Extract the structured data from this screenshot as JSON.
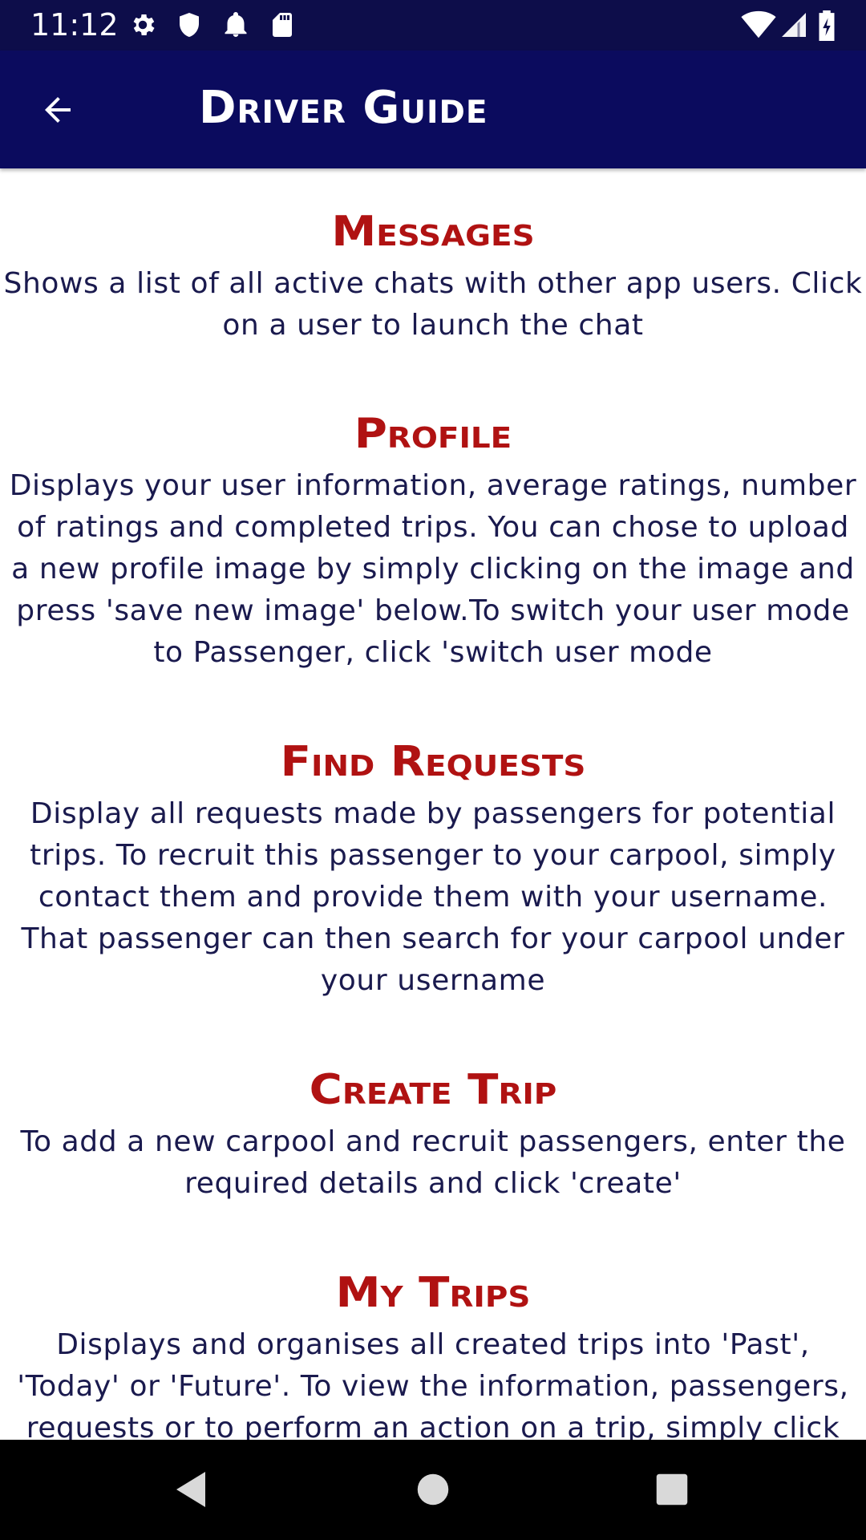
{
  "status_bar": {
    "time": "11:12",
    "left_icons": [
      "gear-icon",
      "shield-icon",
      "bell-icon",
      "sd-card-icon"
    ],
    "right_icons": [
      "wifi-icon",
      "signal-icon",
      "battery-charging-icon"
    ]
  },
  "app_bar": {
    "title": "Driver Guide",
    "back_icon": "arrow-back-icon"
  },
  "sections": [
    {
      "title": "Messages",
      "text": "Shows a list of all active chats with other app users. Click on a user to launch the chat"
    },
    {
      "title": "Profile",
      "text": "Displays your user information, average ratings, number of ratings and completed trips. You can chose to upload a new profile image by simply clicking on the image and press 'save new image' below.To switch your user mode to Passenger, click 'switch user mode"
    },
    {
      "title": "Find Requests",
      "text": "Display all requests made by passengers for potential trips. To recruit this passenger to your carpool, simply contact them and provide them with your username. That passenger can then search for your carpool under your username"
    },
    {
      "title": "Create Trip",
      "text": "To add a new carpool and recruit passengers, enter the required details and click 'create'"
    },
    {
      "title": "My Trips",
      "text": "Displays and organises all created trips into 'Past', 'Today' or 'Future'. To view the information, passengers, requests or to perform an action on a trip, simply click"
    }
  ],
  "nav_bar": {
    "icons": [
      "back-triangle-icon",
      "home-circle-icon",
      "recents-square-icon"
    ]
  },
  "colors": {
    "status_bar": "#0d0d4a",
    "app_bar": "#0b0b5e",
    "section_title": "#b01212",
    "body_text": "#1a1a4e"
  }
}
